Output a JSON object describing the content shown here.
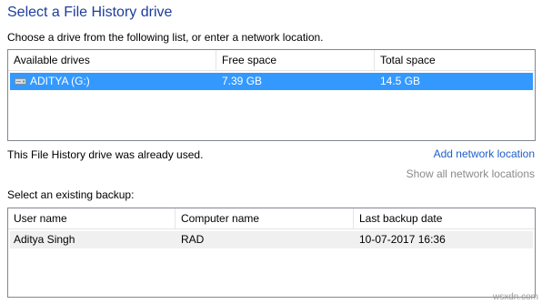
{
  "title": "Select a File History drive",
  "subtitle": "Choose a drive from the following list, or enter a network location.",
  "drives": {
    "columns": [
      "Available drives",
      "Free space",
      "Total space"
    ],
    "rows": [
      {
        "name": "ADITYA (G:)",
        "free": "7.39 GB",
        "total": "14.5 GB",
        "icon": "drive-icon"
      }
    ]
  },
  "status_text": "This File History drive was already used.",
  "links": {
    "add_network": "Add network location",
    "show_network": "Show all network locations"
  },
  "backup": {
    "label": "Select an existing backup:",
    "columns": [
      "User name",
      "Computer name",
      "Last backup date"
    ],
    "rows": [
      {
        "user": "Aditya Singh",
        "computer": "RAD",
        "date": "10-07-2017 16:36"
      }
    ]
  },
  "watermark": "wsxdn.com",
  "colors": {
    "title": "#1e3d9c",
    "link": "#1e5ec8",
    "disabled_link": "#8a8a8a",
    "selection": "#3399ff"
  }
}
